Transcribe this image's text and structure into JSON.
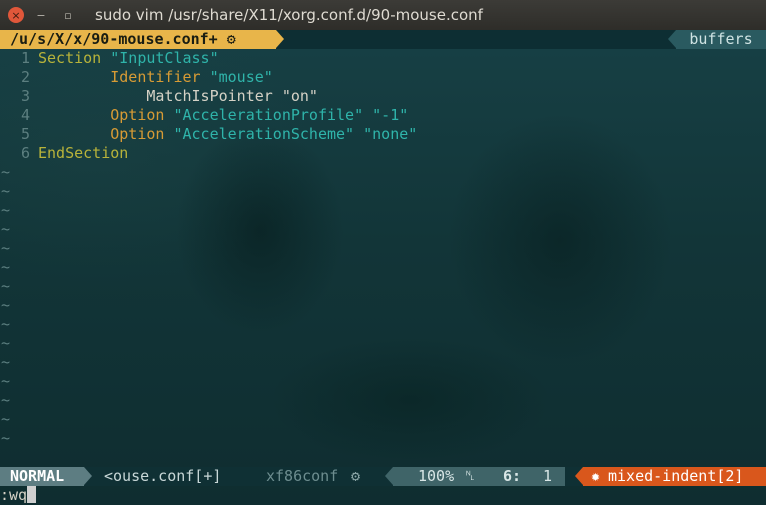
{
  "window": {
    "title": "sudo vim /usr/share/X11/xorg.conf.d/90-mouse.conf",
    "close_glyph": "×",
    "minimize_glyph": "−",
    "maximize_glyph": "▫"
  },
  "tabline": {
    "active_tab": "/u/s/X/x/90-mouse.conf+",
    "active_tab_icon": "⚙",
    "buffers_label": "buffers"
  },
  "buffer": {
    "lines": [
      {
        "num": "1",
        "segments": [
          {
            "t": "Section ",
            "c": "kw"
          },
          {
            "t": "\"InputClass\"",
            "c": "str"
          }
        ]
      },
      {
        "num": "2",
        "segments": [
          {
            "t": "        Identifier ",
            "c": "kw2"
          },
          {
            "t": "\"mouse\"",
            "c": "str"
          }
        ]
      },
      {
        "num": "3",
        "segments": [
          {
            "t": "            MatchIsPointer \"on\"",
            "c": "plain"
          }
        ]
      },
      {
        "num": "4",
        "segments": [
          {
            "t": "        Option ",
            "c": "kw2"
          },
          {
            "t": "\"AccelerationProfile\" \"-1\"",
            "c": "str"
          }
        ]
      },
      {
        "num": "5",
        "segments": [
          {
            "t": "        Option ",
            "c": "kw2"
          },
          {
            "t": "\"AccelerationScheme\" \"none\"",
            "c": "str"
          }
        ]
      },
      {
        "num": "6",
        "segments": [
          {
            "t": "EndSection",
            "c": "kw"
          }
        ]
      }
    ],
    "empty_line_marker": "~",
    "empty_line_count": 15
  },
  "statusline": {
    "mode": "NORMAL",
    "file": "<ouse.conf[+]",
    "filetype": "xf86conf",
    "filetype_icon": "⚙",
    "percent": "100%",
    "line_icon": "␤",
    "line": "6:",
    "col": "1",
    "warning_icon": "✹",
    "warning": "mixed-indent[2]"
  },
  "cmdline": {
    "text": ":wq"
  },
  "colors": {
    "tab_active": "#e8b54a",
    "mode_bg": "#5d7d82",
    "warning_bg": "#d9571c",
    "keyword": "#b8b33a",
    "string": "#2fb4aa"
  }
}
